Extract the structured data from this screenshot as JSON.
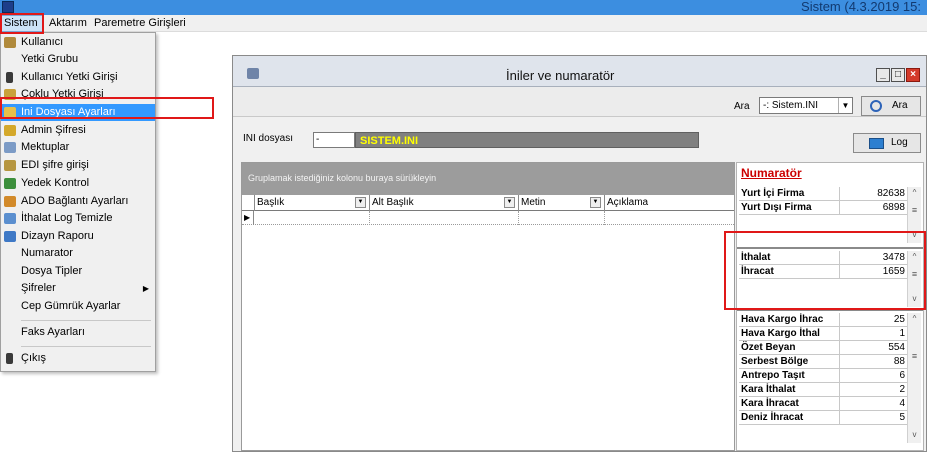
{
  "app": {
    "title": "Sistem (4.3.2019 15:"
  },
  "menubar": {
    "items": [
      "Sistem",
      "Aktarım",
      "Paremetre Girişleri"
    ]
  },
  "dropdown": {
    "items": [
      {
        "label": "Kullanıcı",
        "icon": "users-icon"
      },
      {
        "label": "Yetki Grubu",
        "icon": ""
      },
      {
        "label": "Kullanıcı Yetki Girişi",
        "icon": "user-key-icon"
      },
      {
        "label": "Çoklu Yetki Girişi",
        "icon": "multi-key-icon"
      },
      {
        "label": "Ini Dosyası Ayarları",
        "icon": "ini-settings-icon",
        "highlighted": true
      },
      {
        "label": "Admin Şifresi",
        "icon": "key-icon"
      },
      {
        "label": "Mektuplar",
        "icon": "letter-icon"
      },
      {
        "label": "EDI şifre girişi",
        "icon": "edi-key-icon"
      },
      {
        "label": "Yedek Kontrol",
        "icon": "backup-icon"
      },
      {
        "label": "ADO Bağlantı Ayarları",
        "icon": "connection-icon"
      },
      {
        "label": "İthalat Log Temizle",
        "icon": "clean-log-icon"
      },
      {
        "label": "Dizayn Raporu",
        "icon": "report-icon"
      },
      {
        "label": "Numarator",
        "icon": ""
      },
      {
        "label": "Dosya Tipler",
        "icon": ""
      },
      {
        "label": "Şifreler",
        "icon": "",
        "submenu": true
      },
      {
        "label": "Cep Gümrük Ayarlar",
        "icon": ""
      },
      {
        "label": "Faks Ayarları",
        "icon": ""
      },
      {
        "label": "Çıkış",
        "icon": "exit-icon"
      }
    ]
  },
  "child": {
    "title": "İniler ve numaratör",
    "search": {
      "label": "Ara",
      "selected": "-: Sistem.INI",
      "button": "Ara"
    },
    "ini": {
      "label": "INI dosyası",
      "input_value": "-",
      "value": "SISTEM.INI"
    },
    "log_button": "Log",
    "grid": {
      "group_hint": "Gruplamak istediğiniz kolonu buraya sürükleyin",
      "columns": [
        "Başlık",
        "Alt Başlık",
        "Metin",
        "Açıklama"
      ]
    },
    "numerator": {
      "title": "Numaratör",
      "group1": [
        {
          "name": "Yurt İçi Firma",
          "value": "82638"
        },
        {
          "name": "Yurt Dışı Firma",
          "value": "6898"
        }
      ],
      "group2": [
        {
          "name": "İthalat",
          "value": "3478"
        },
        {
          "name": "İhracat",
          "value": "1659"
        }
      ],
      "group3": [
        {
          "name": "Hava Kargo İhrac",
          "value": "25"
        },
        {
          "name": "Hava Kargo İthal",
          "value": "1"
        },
        {
          "name": "Özet Beyan",
          "value": "554"
        },
        {
          "name": "Serbest Bölge",
          "value": "88"
        },
        {
          "name": "Antrepo Taşıt",
          "value": "6"
        },
        {
          "name": "Kara İthalat",
          "value": "2"
        },
        {
          "name": "Kara İhracat",
          "value": "4"
        },
        {
          "name": "Deniz İhracat",
          "value": "5"
        }
      ]
    }
  },
  "colors": {
    "titlebar": "#3c8ee0",
    "highlight": "#3399ff",
    "annotation": "#e01818",
    "ini_value_bg": "#808080",
    "ini_value_fg": "#ffff00",
    "numerator_title": "#cc0000"
  }
}
